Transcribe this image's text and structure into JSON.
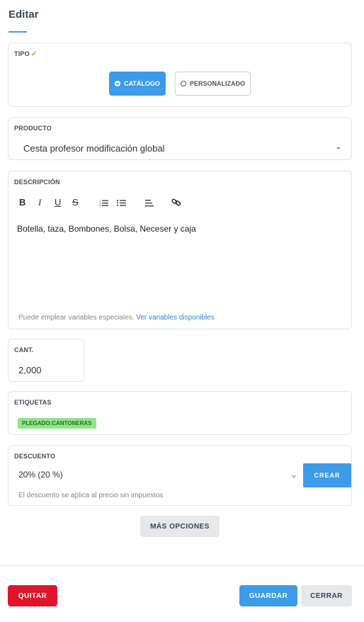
{
  "header": {
    "title": "Editar"
  },
  "tipo": {
    "label": "TIPO",
    "check": "✓",
    "options": [
      {
        "label": "CATÁLOGO",
        "selected": true
      },
      {
        "label": "PERSONALIZADO",
        "selected": false
      }
    ]
  },
  "producto": {
    "label": "PRODUCTO",
    "value": "Cesta profesor modificación global"
  },
  "descripcion": {
    "label": "DESCRIPCIÓN",
    "toolbar": [
      "bold-icon",
      "italic-icon",
      "underline-icon",
      "strikethrough-icon",
      "ordered-list-icon",
      "bullet-list-icon",
      "align-left-icon",
      "link-icon"
    ],
    "text": "Botella, taza, Bombones, Bolsa, Neceser y caja",
    "hint_text": "Puede emplear variables especiales.",
    "hint_link": "Ver variables disponibles"
  },
  "cantidad": {
    "label": "CANT.",
    "value": "2,000"
  },
  "etiquetas": {
    "label": "ETIQUETAS",
    "tags": [
      "PLEGADO:CANTONERAS"
    ]
  },
  "descuento": {
    "label": "DESCUENTO",
    "value": "20% (20 %)",
    "create_label": "CREAR",
    "hint": "El descuento se aplica al precio sin impuestos"
  },
  "more_options_label": "MÁS OPCIONES",
  "footer": {
    "remove_label": "QUITAR",
    "save_label": "GUARDAR",
    "close_label": "CERRAR"
  },
  "colors": {
    "accent": "#3d9be9",
    "danger": "#e0152b",
    "tag_bg": "#8fe58a"
  }
}
